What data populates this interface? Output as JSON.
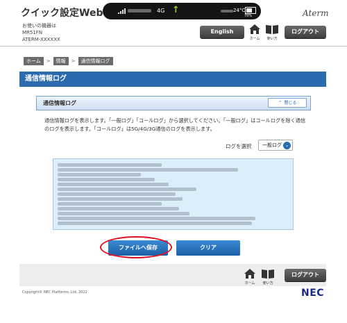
{
  "header": {
    "title": "クイック設定Web",
    "device_caption": [
      "お使いの機器は",
      "MR51FN",
      "ATERM-XXXXXX"
    ],
    "status": {
      "network": "4G",
      "temperature": "24°C",
      "battery": "70%"
    },
    "logo": "Aterm",
    "english_label": "English",
    "home_label": "ホーム",
    "help_label": "使い方",
    "logout_label": "ログアウト"
  },
  "breadcrumb": {
    "items": [
      "ホーム",
      "情報",
      "通信情報ログ"
    ],
    "separator": ">"
  },
  "page_title": "通信情報ログ",
  "panel": {
    "title": "通信情報ログ",
    "close_label": "閉じる",
    "description": "通信情報ログを表示します。「一般ログ」「コールログ」から選択してください。「一般ログ」はコールログを除く通信のログを表示します。「コールログ」は5G/4G/3G通信のログを表示します。"
  },
  "log_select": {
    "label": "ログを選択",
    "value": "一般ログ"
  },
  "buttons": {
    "save": "ファイルへ保存",
    "clear": "クリア"
  },
  "footer": {
    "home_label": "ホーム",
    "help_label": "使い方",
    "logout_label": "ログアウト",
    "copyright": "Copyright© NEC Platforms, Ltd. 2022",
    "logo": "NEC"
  },
  "colors": {
    "accent": "#2a6bb0",
    "highlight": "#e01020"
  }
}
